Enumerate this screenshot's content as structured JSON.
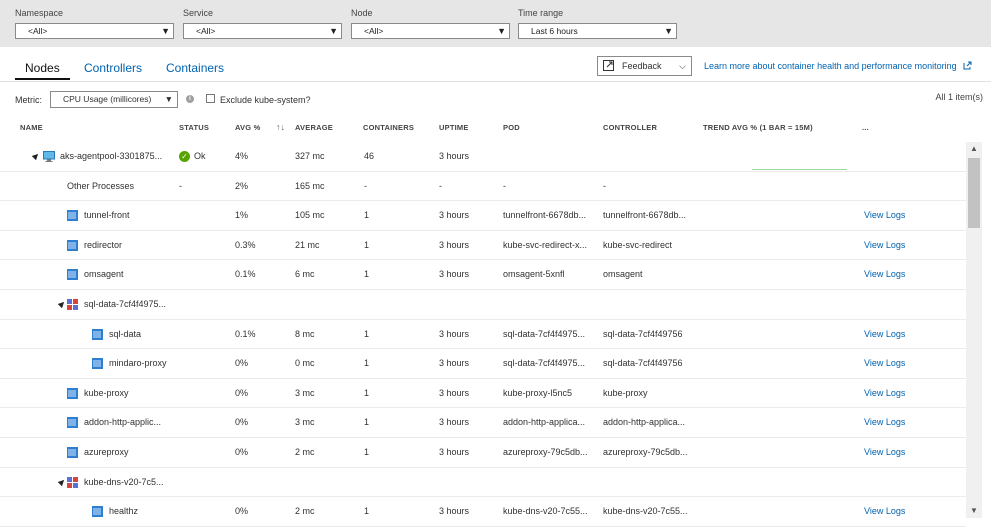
{
  "filters": [
    {
      "label": "Namespace",
      "value": "<All>"
    },
    {
      "label": "Service",
      "value": "<All>"
    },
    {
      "label": "Node",
      "value": "<All>"
    },
    {
      "label": "Time range",
      "value": "Last 6 hours"
    }
  ],
  "tabs": [
    "Nodes",
    "Controllers",
    "Containers"
  ],
  "active_tab": "Nodes",
  "feedback": {
    "label": "Feedback"
  },
  "learn_more": "Learn more about container health and performance monitoring",
  "metric": {
    "label": "Metric:",
    "value": "CPU Usage (millicores)"
  },
  "exclude": {
    "label": "Exclude kube-system?",
    "checked": false
  },
  "item_count": "All 1 item(s)",
  "columns": [
    "NAME",
    "STATUS",
    "AVG %",
    "AVERAGE",
    "CONTAINERS",
    "UPTIME",
    "POD",
    "CONTROLLER",
    "TREND AVG % (1 BAR = 15M)",
    "..."
  ],
  "rows": [
    {
      "name": "aks-agentpool-3301875...",
      "status": "Ok",
      "avg_pct": "4%",
      "average": "327 mc",
      "containers": "46",
      "uptime": "3 hours",
      "pod": "",
      "controller": "",
      "logs": ""
    },
    {
      "name": "Other Processes",
      "status": "-",
      "avg_pct": "2%",
      "average": "165 mc",
      "containers": "-",
      "uptime": "-",
      "pod": "-",
      "controller": "-",
      "logs": ""
    },
    {
      "name": "tunnel-front",
      "status": "",
      "avg_pct": "1%",
      "average": "105 mc",
      "containers": "1",
      "uptime": "3 hours",
      "pod": "tunnelfront-6678db...",
      "controller": "tunnelfront-6678db...",
      "logs": "View Logs"
    },
    {
      "name": "redirector",
      "status": "",
      "avg_pct": "0.3%",
      "average": "21 mc",
      "containers": "1",
      "uptime": "3 hours",
      "pod": "kube-svc-redirect-x...",
      "controller": "kube-svc-redirect",
      "logs": "View Logs"
    },
    {
      "name": "omsagent",
      "status": "",
      "avg_pct": "0.1%",
      "average": "6 mc",
      "containers": "1",
      "uptime": "3 hours",
      "pod": "omsagent-5xnfl",
      "controller": "omsagent",
      "logs": "View Logs"
    },
    {
      "name": "sql-data-7cf4f4975...",
      "status": "",
      "avg_pct": "",
      "average": "",
      "containers": "",
      "uptime": "",
      "pod": "",
      "controller": "",
      "logs": ""
    },
    {
      "name": "sql-data",
      "status": "",
      "avg_pct": "0.1%",
      "average": "8 mc",
      "containers": "1",
      "uptime": "3 hours",
      "pod": "sql-data-7cf4f4975...",
      "controller": "sql-data-7cf4f49756",
      "logs": "View Logs"
    },
    {
      "name": "mindaro-proxy",
      "status": "",
      "avg_pct": "0%",
      "average": "0 mc",
      "containers": "1",
      "uptime": "3 hours",
      "pod": "sql-data-7cf4f4975...",
      "controller": "sql-data-7cf4f49756",
      "logs": "View Logs"
    },
    {
      "name": "kube-proxy",
      "status": "",
      "avg_pct": "0%",
      "average": "3 mc",
      "containers": "1",
      "uptime": "3 hours",
      "pod": "kube-proxy-l5nc5",
      "controller": "kube-proxy",
      "logs": "View Logs"
    },
    {
      "name": "addon-http-applic...",
      "status": "",
      "avg_pct": "0%",
      "average": "3 mc",
      "containers": "1",
      "uptime": "3 hours",
      "pod": "addon-http-applica...",
      "controller": "addon-http-applica...",
      "logs": "View Logs"
    },
    {
      "name": "azureproxy",
      "status": "",
      "avg_pct": "0%",
      "average": "2 mc",
      "containers": "1",
      "uptime": "3 hours",
      "pod": "azureproxy-79c5db...",
      "controller": "azureproxy-79c5db...",
      "logs": "View Logs"
    },
    {
      "name": "kube-dns-v20-7c5...",
      "status": "",
      "avg_pct": "",
      "average": "",
      "containers": "",
      "uptime": "",
      "pod": "",
      "controller": "",
      "logs": ""
    },
    {
      "name": "healthz",
      "status": "",
      "avg_pct": "0%",
      "average": "2 mc",
      "containers": "1",
      "uptime": "3 hours",
      "pod": "kube-dns-v20-7c55...",
      "controller": "kube-dns-v20-7c55...",
      "logs": "View Logs"
    }
  ],
  "icons": {
    "node": "vm-icon",
    "container": "container-icon",
    "pod": "pod-icon",
    "status_ok": "check-circle-icon"
  },
  "colors": {
    "accent": "#0063b1",
    "ok": "#57a300",
    "filterbar": "#e6e6e6"
  }
}
